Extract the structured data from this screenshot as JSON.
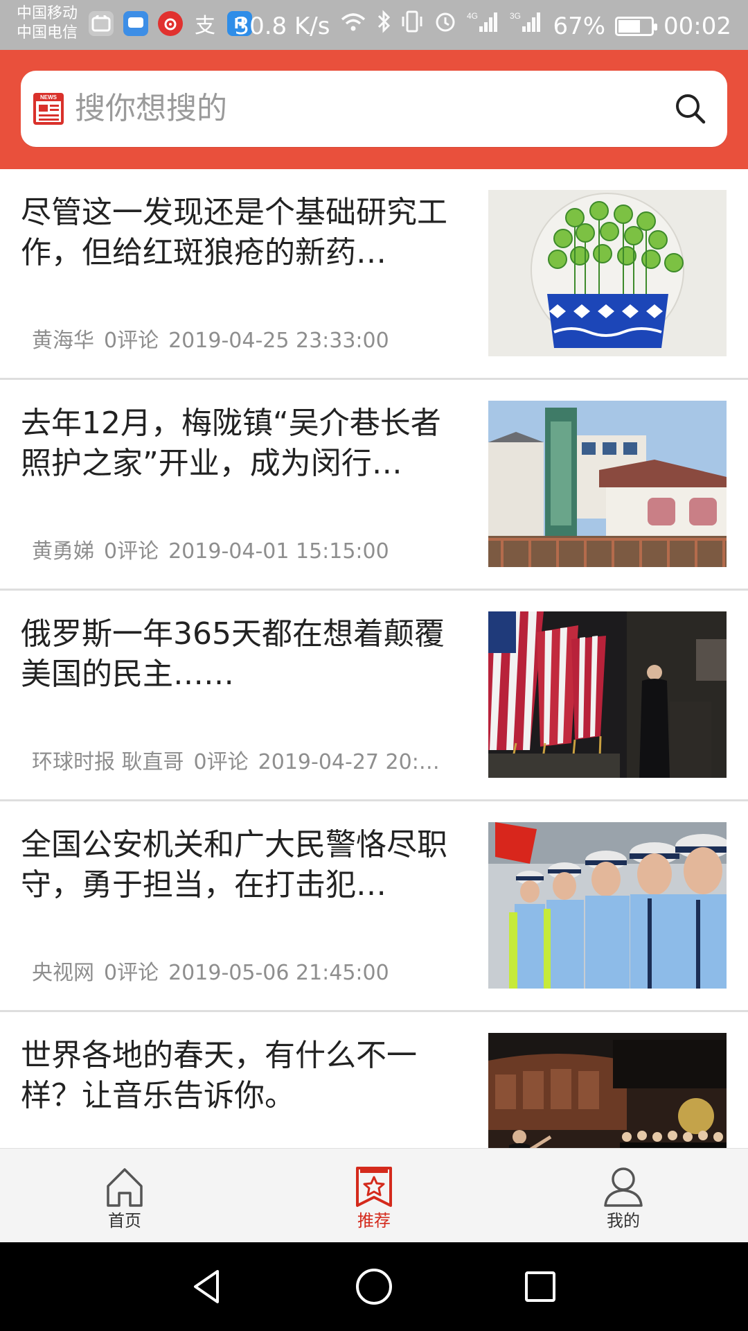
{
  "status_bar": {
    "carrier_1": "中国移动",
    "carrier_2": "中国电信",
    "net_speed": "30.8 K/s",
    "battery": "67%",
    "battery_level": 0.67,
    "time": "00:02",
    "icons": [
      "huawei-app-icon",
      "message-app-icon",
      "netease-music-icon",
      "alipay-icon",
      "h-app-icon",
      "wifi-icon",
      "bluetooth-icon",
      "vibrate-icon",
      "alarm-icon",
      "signal-4g-icon",
      "signal-3g-icon",
      "battery-icon"
    ]
  },
  "search": {
    "placeholder": "搜你想搜的",
    "icon": "search-icon",
    "logo_icon": "news-icon",
    "logo_text": "NEWS"
  },
  "colors": {
    "header": "#e9503c",
    "accent": "#d42a1c",
    "meta_text": "#8e8e8e",
    "title_text": "#222222"
  },
  "articles": [
    {
      "title": "尽管这一发现还是个基础研究工作，但给红斑狼疮的新药…",
      "source": "黄海华",
      "comments": "0评论",
      "time": "2019-04-25 23:33:00",
      "thumb": "potted-plant-drawing"
    },
    {
      "title": "去年12月，梅陇镇“吴介巷长者照护之家”开业，成为闵行…",
      "source": "黄勇娣",
      "comments": "0评论",
      "time": "2019-04-01 15:15:00",
      "thumb": "elder-care-building"
    },
    {
      "title": "俄罗斯一年365天都在想着颠覆美国的民主……",
      "source": "环球时报 耿直哥",
      "comments": "0评论",
      "time": "2019-04-27 20:…",
      "thumb": "us-flags-podium"
    },
    {
      "title": "全国公安机关和广大民警恪尽职守，勇于担当，在打击犯…",
      "source": "央视网",
      "comments": "0评论",
      "time": "2019-05-06 21:45:00",
      "thumb": "police-officers-lineup"
    },
    {
      "title": "世界各地的春天，有什么不一样？让音乐告诉你。",
      "source": "",
      "comments": "",
      "time": "",
      "thumb": "choir-concert"
    }
  ],
  "bottom_nav": [
    {
      "label": "首页",
      "icon": "home-icon",
      "active": false
    },
    {
      "label": "推荐",
      "icon": "recommend-star-icon",
      "active": true
    },
    {
      "label": "我的",
      "icon": "profile-icon",
      "active": false
    }
  ],
  "system_nav": [
    "back-icon",
    "home-circle-icon",
    "recents-icon"
  ]
}
